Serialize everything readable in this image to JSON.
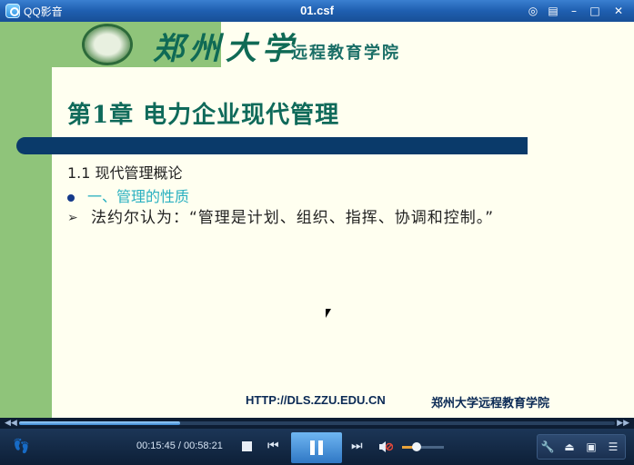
{
  "window": {
    "app_name": "QQ影音",
    "file_title": "01.csf"
  },
  "slide": {
    "university": "郑州大学",
    "college": "远程教育学院",
    "chapter_title": "第1章  电力企业现代管理",
    "section": "1.1 现代管理概论",
    "bullet1": "一、管理的性质",
    "bullet2": "法约尔认为：“管理是计划、组织、指挥、协调和控制。”",
    "url": "HTTP://DLS.ZZU.EDU.CN",
    "footer_college": "郑州大学远程教育学院"
  },
  "player": {
    "time": "00:15:45 / 00:58:21",
    "progress": 0.27,
    "volume": 0.35
  }
}
